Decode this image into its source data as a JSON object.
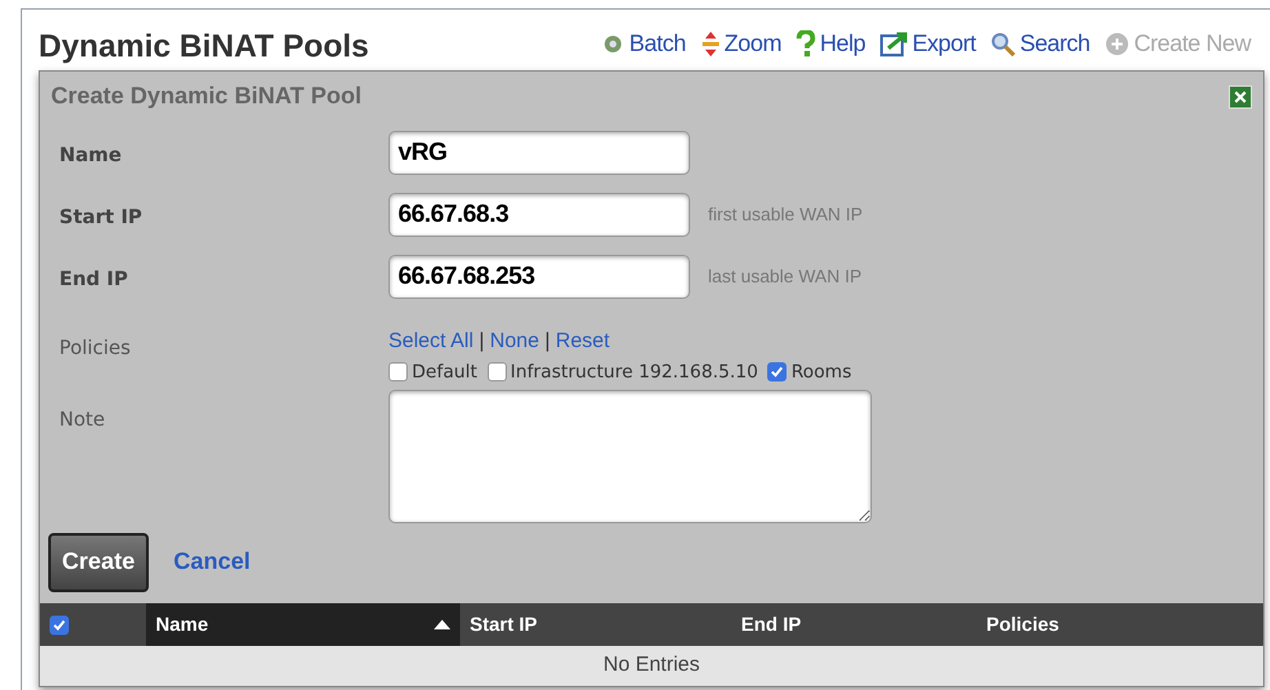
{
  "page": {
    "title": "Dynamic BiNAT Pools"
  },
  "toolbar": [
    {
      "kind": "batch",
      "label": "Batch",
      "disabled": false
    },
    {
      "kind": "zoom",
      "label": "Zoom",
      "disabled": false
    },
    {
      "kind": "help",
      "label": "Help",
      "disabled": false
    },
    {
      "kind": "export",
      "label": "Export",
      "disabled": false
    },
    {
      "kind": "search",
      "label": "Search",
      "disabled": false
    },
    {
      "kind": "create",
      "label": "Create New",
      "disabled": true
    }
  ],
  "form": {
    "title": "Create Dynamic BiNAT Pool",
    "fields": [
      {
        "label": "Name",
        "value": "vRG"
      },
      {
        "label": "Start IP",
        "value": "66.67.68.3",
        "hint": "first usable WAN IP"
      },
      {
        "label": "End IP",
        "value": "66.67.68.253",
        "hint": "last usable WAN IP"
      }
    ],
    "policies": {
      "label": "Policies",
      "links": [
        "Select All",
        "None",
        "Reset"
      ],
      "separators": [
        "|",
        "|"
      ],
      "options": [
        {
          "label": "Default",
          "checked": false
        },
        {
          "label": "Infrastructure 192.168.5.10",
          "checked": false
        },
        {
          "label": "Rooms",
          "checked": true
        }
      ]
    },
    "note": {
      "label": "Note"
    },
    "buttons": {
      "create": "Create",
      "cancel": "Cancel"
    }
  },
  "table": {
    "select_all_checked": true,
    "columns": [
      {
        "label": "Name",
        "sorted": true
      },
      {
        "label": "Start IP",
        "sorted": false
      },
      {
        "label": "End IP",
        "sorted": false
      },
      {
        "label": "Policies",
        "sorted": false
      }
    ],
    "empty": "No Entries"
  }
}
